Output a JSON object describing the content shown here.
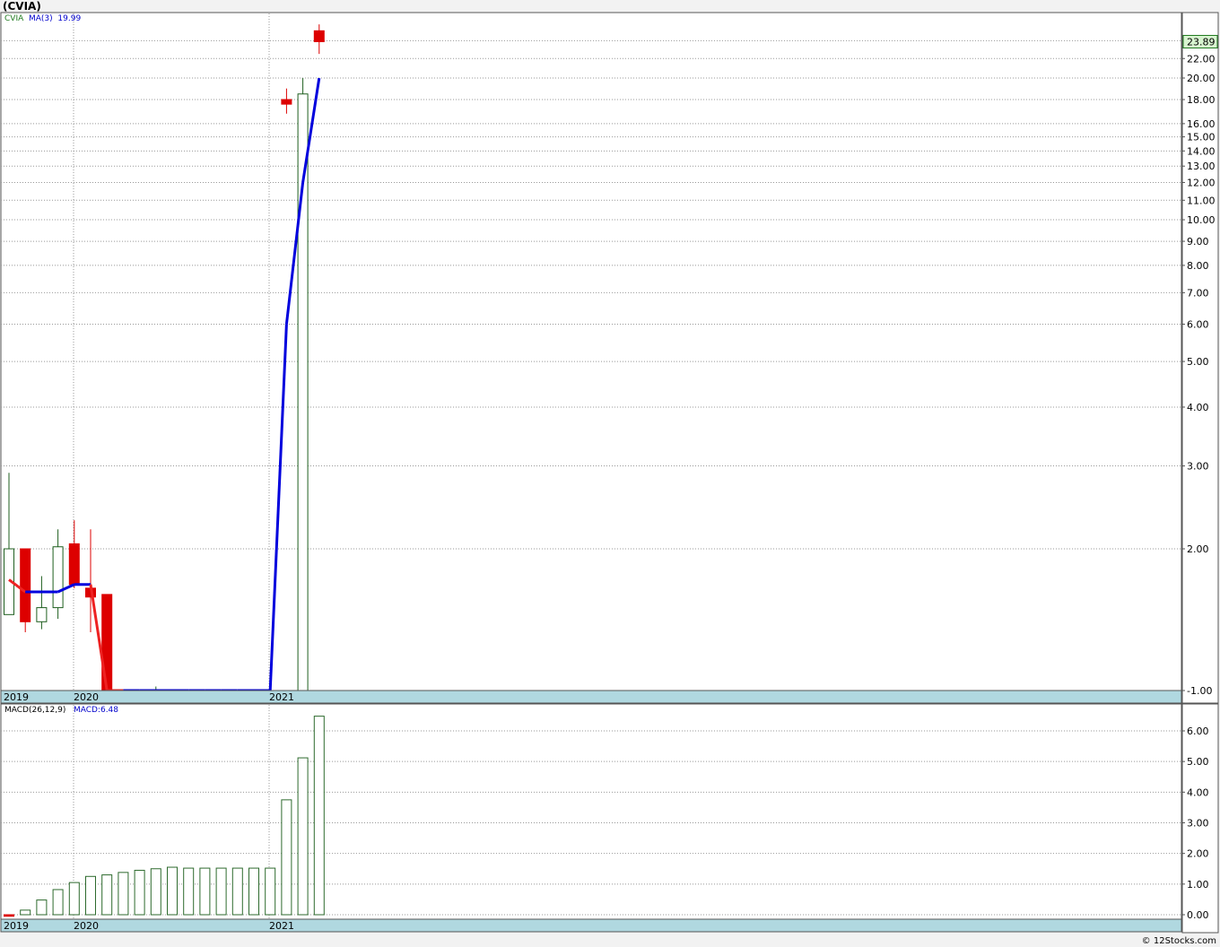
{
  "title": "(CVIA)",
  "credit": "© 12Stocks.com",
  "colors": {
    "up": "#1f5f1f",
    "down": "#dd0000",
    "ma_up": "#0000dd",
    "ma_down": "#ee2222",
    "macd_bar": "#2d6a2d",
    "axis_bar": "#b0d8e0",
    "price_badge": "#d8f5d0"
  },
  "price_panel": {
    "legend": {
      "symbol": "CVIA",
      "ma_label": "MA(3)",
      "ma_value": "19.99"
    },
    "last_price": "23.89",
    "y_ticks": [
      "24.00",
      "22.00",
      "20.00",
      "18.00",
      "16.00",
      "15.00",
      "14.00",
      "13.00",
      "12.00",
      "11.00",
      "10.00",
      "9.00",
      "8.00",
      "7.00",
      "6.00",
      "5.00",
      "4.00",
      "3.00",
      "2.00",
      "-1.00"
    ],
    "x_labels": [
      "2019",
      "2020",
      "2021"
    ]
  },
  "macd_panel": {
    "legend": {
      "label": "MACD(26,12,9)",
      "value": "MACD:6.48"
    },
    "y_ticks": [
      "6.00",
      "5.00",
      "4.00",
      "3.00",
      "2.00",
      "1.00",
      "0.00"
    ],
    "x_labels": [
      "2019",
      "2020",
      "2021"
    ]
  },
  "chart_data": [
    {
      "type": "candlestick",
      "title": "(CVIA)",
      "y_scale": "log",
      "ylim": [
        1.0,
        26
      ],
      "x_labels": [
        "2019",
        "2020",
        "2021"
      ],
      "candles": [
        {
          "o": 1.45,
          "h": 2.9,
          "l": 1.45,
          "c": 2.0
        },
        {
          "o": 2.0,
          "h": 2.0,
          "l": 1.33,
          "c": 1.4
        },
        {
          "o": 1.4,
          "h": 1.75,
          "l": 1.35,
          "c": 1.5
        },
        {
          "o": 1.5,
          "h": 2.2,
          "l": 1.42,
          "c": 2.02
        },
        {
          "o": 2.05,
          "h": 2.3,
          "l": 1.65,
          "c": 1.68
        },
        {
          "o": 1.65,
          "h": 2.2,
          "l": 1.33,
          "c": 1.58
        },
        {
          "o": 1.6,
          "h": 1.6,
          "l": 0.8,
          "c": 0.8
        },
        {
          "o": 0.9,
          "h": 0.95,
          "l": 0.85,
          "c": 0.9
        },
        {
          "o": 0.9,
          "h": 0.95,
          "l": 0.85,
          "c": 0.9
        },
        {
          "o": 0.9,
          "h": 1.02,
          "l": 0.85,
          "c": 0.9
        },
        {
          "o": 0.9,
          "h": 0.95,
          "l": 0.85,
          "c": 0.9
        },
        {
          "o": 0.9,
          "h": 0.95,
          "l": 0.85,
          "c": 0.9
        },
        {
          "o": 0.9,
          "h": 0.95,
          "l": 0.85,
          "c": 0.9
        },
        {
          "o": 0.9,
          "h": 0.95,
          "l": 0.85,
          "c": 0.9
        },
        {
          "o": 0.9,
          "h": 0.95,
          "l": 0.85,
          "c": 0.9
        },
        {
          "o": 0.9,
          "h": 0.95,
          "l": 0.85,
          "c": 0.9
        },
        {
          "o": 0.9,
          "h": 0.95,
          "l": 0.85,
          "c": 0.9
        },
        {
          "o": 18.0,
          "h": 19.0,
          "l": 16.8,
          "c": 17.6
        },
        {
          "o": 0.9,
          "h": 20.0,
          "l": 0.85,
          "c": 18.5
        },
        {
          "o": 25.2,
          "h": 26.0,
          "l": 22.5,
          "c": 23.89
        }
      ],
      "ma3": [
        1.72,
        1.62,
        1.62,
        1.62,
        1.68,
        1.68,
        1.0,
        0.9,
        0.9,
        0.9,
        0.9,
        0.9,
        0.9,
        0.9,
        0.9,
        0.9,
        0.95,
        6.0,
        12.0,
        19.99
      ]
    },
    {
      "type": "bar",
      "title": "MACD(26,12,9)",
      "ylim": [
        -0.1,
        6.9
      ],
      "values": [
        -0.05,
        0.15,
        0.48,
        0.82,
        1.05,
        1.25,
        1.3,
        1.38,
        1.45,
        1.5,
        1.55,
        1.52,
        1.52,
        1.52,
        1.52,
        1.52,
        1.52,
        3.75,
        5.12,
        6.48
      ]
    }
  ]
}
